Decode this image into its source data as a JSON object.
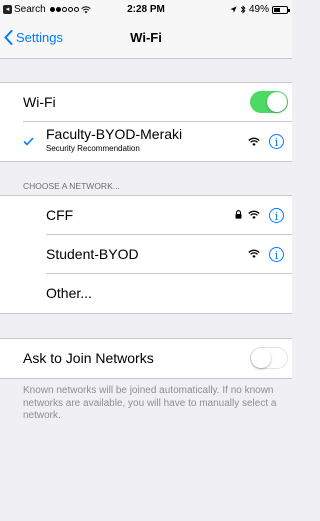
{
  "status_bar": {
    "back_app": "Search",
    "time": "2:28 PM",
    "battery": "49%",
    "battery_level": 0.49
  },
  "nav": {
    "back_label": "Settings",
    "title": "Wi-Fi"
  },
  "wifi_toggle": {
    "label": "Wi-Fi",
    "on": true
  },
  "connected": {
    "name": "Faculty-BYOD-Meraki",
    "subtitle": "Security Recommendation"
  },
  "networks_header": "CHOOSE A NETWORK...",
  "networks": [
    {
      "name": "CFF",
      "locked": true
    },
    {
      "name": "Student-BYOD",
      "locked": false
    }
  ],
  "other_label": "Other...",
  "ask_to_join": {
    "label": "Ask to Join Networks",
    "on": false
  },
  "footer": "Known networks will be joined automatically. If no known networks are available, you will have to manually select a network.",
  "colors": {
    "accent": "#007aff",
    "toggle_on": "#4cd964",
    "background": "#efeff4"
  }
}
